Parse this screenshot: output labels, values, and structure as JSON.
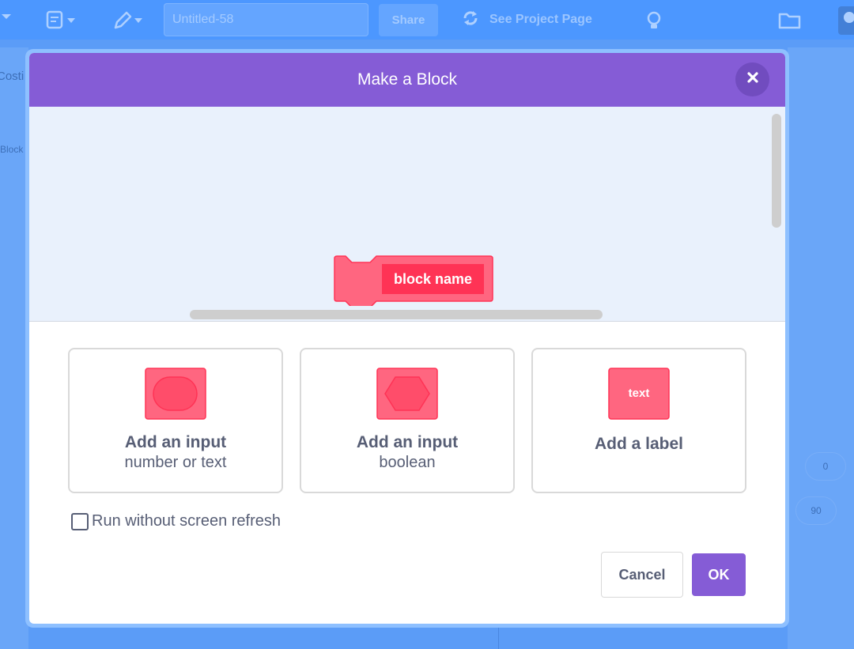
{
  "menubar": {
    "project_title": "Untitled-58",
    "share_label": "Share",
    "see_project_label": "See Project Page",
    "icons": [
      "caret-down-icon",
      "file-menu-icon",
      "edit-menu-icon",
      "remix-icon",
      "tutorials-icon",
      "folder-icon",
      "avatar-icon"
    ]
  },
  "background": {
    "tab_label": "Costi",
    "category_label": "Block",
    "field_values": [
      "0",
      "90"
    ]
  },
  "dialog": {
    "title": "Make a Block",
    "close_icon": "close-icon",
    "block_name": "block name",
    "options": [
      {
        "title": "Add an input",
        "subtitle": "number or text",
        "icon": "reporter-input-icon"
      },
      {
        "title": "Add an input",
        "subtitle": "boolean",
        "icon": "boolean-input-icon"
      },
      {
        "title": "Add a label",
        "subtitle": "",
        "icon": "label-icon",
        "icon_text": "text"
      }
    ],
    "refresh_label": "Run without screen refresh",
    "refresh_checked": false,
    "cancel_label": "Cancel",
    "ok_label": "OK"
  },
  "colors": {
    "menubar": "#4c97ff",
    "dialog_header": "#855cd6",
    "block_fill": "#ff6680",
    "block_field": "#ff3355",
    "text": "#575e75"
  }
}
